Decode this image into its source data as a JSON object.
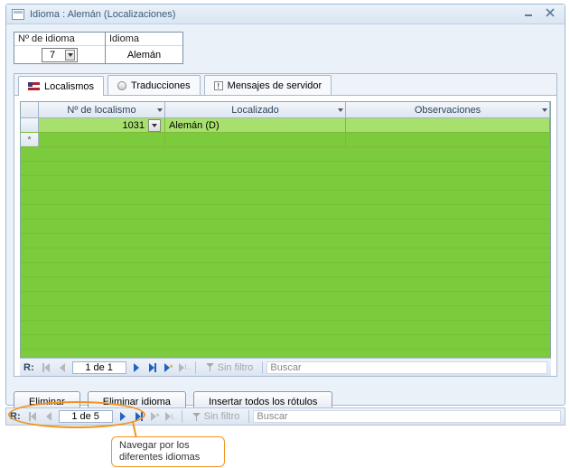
{
  "window": {
    "title": "Idioma : Alemán (Localizaciones)"
  },
  "fields": {
    "num_label": "Nº de idioma",
    "num_value": "7",
    "name_label": "Idioma",
    "name_value": "Alemán"
  },
  "tabs": {
    "localismos": "Localismos",
    "traducciones": "Traducciones",
    "mensajes": "Mensajes de servidor"
  },
  "grid": {
    "headers": {
      "num": "Nº de localismo",
      "localizado": "Localizado",
      "observaciones": "Observaciones"
    },
    "rows": [
      {
        "num": "1031",
        "localizado": "Alemán (D)",
        "observaciones": ""
      }
    ]
  },
  "nav_inner": {
    "prefix": "R:",
    "pos": "1 de 1",
    "filter_label": "Sin filtro",
    "search_placeholder": "Buscar"
  },
  "buttons": {
    "eliminar": "Eliminar",
    "eliminar_idioma": "Eliminar idioma",
    "insertar": "Insertar todos los rótulos"
  },
  "nav_outer": {
    "prefix": "R:",
    "pos": "1 de 5",
    "filter_label": "Sin filtro",
    "search_placeholder": "Buscar"
  },
  "callout": {
    "text": "Navegar por los diferentes idiomas"
  }
}
